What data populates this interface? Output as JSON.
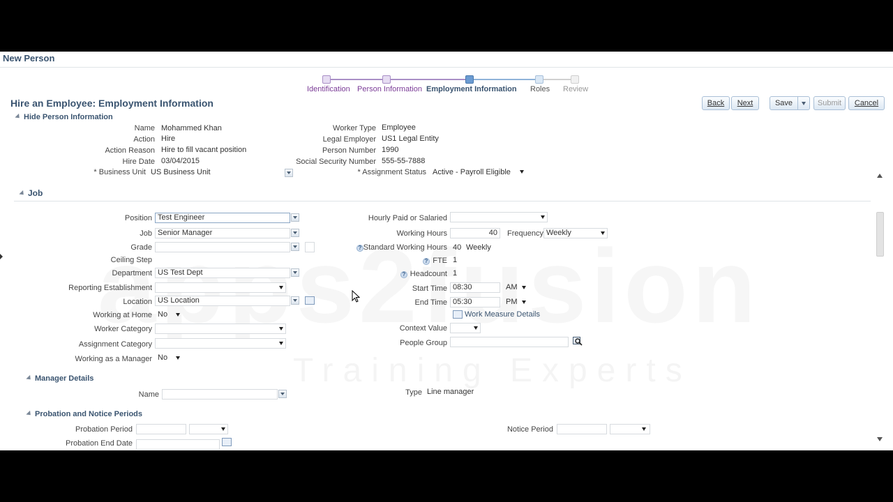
{
  "page": {
    "title": "New Person"
  },
  "train": {
    "stops": [
      {
        "label": "Identification",
        "state": "visited"
      },
      {
        "label": "Person Information",
        "state": "visited"
      },
      {
        "label": "Employment Information",
        "state": "current"
      },
      {
        "label": "Roles",
        "state": "future"
      },
      {
        "label": "Review",
        "state": "disabled"
      }
    ]
  },
  "header": {
    "section_title": "Hire an Employee: Employment Information",
    "buttons": {
      "back": "Back",
      "next": "Next",
      "save": "Save",
      "submit": "Submit",
      "cancel": "Cancel"
    }
  },
  "person_info": {
    "toggle_label": "Hide Person Information",
    "left": [
      {
        "label": "Name",
        "value": "Mohammed Khan"
      },
      {
        "label": "Action",
        "value": "Hire"
      },
      {
        "label": "Action Reason",
        "value": "Hire to fill vacant position"
      },
      {
        "label": "Hire Date",
        "value": "03/04/2015"
      }
    ],
    "right": [
      {
        "label": "Worker Type",
        "value": "Employee"
      },
      {
        "label": "Legal Employer",
        "value": "US1 Legal Entity"
      },
      {
        "label": "Person Number",
        "value": "1990"
      },
      {
        "label": "Social Security Number",
        "value": "555-55-7888"
      }
    ],
    "business_unit": {
      "label": "Business Unit",
      "value": "US Business Unit"
    },
    "assignment_status": {
      "label": "Assignment Status",
      "value": "Active - Payroll Eligible"
    }
  },
  "job": {
    "section_title": "Job",
    "position": {
      "label": "Position",
      "value": "Test Engineer"
    },
    "job": {
      "label": "Job",
      "value": "Senior Manager"
    },
    "grade": {
      "label": "Grade",
      "value": ""
    },
    "ceiling_step": {
      "label": "Ceiling Step",
      "value": ""
    },
    "department": {
      "label": "Department",
      "value": "US Test Dept"
    },
    "reporting_establishment": {
      "label": "Reporting Establishment",
      "value": ""
    },
    "location": {
      "label": "Location",
      "value": "US Location"
    },
    "working_at_home": {
      "label": "Working at Home",
      "value": "No"
    },
    "worker_category": {
      "label": "Worker Category",
      "value": ""
    },
    "assignment_category": {
      "label": "Assignment Category",
      "value": ""
    },
    "working_as_manager": {
      "label": "Working as a Manager",
      "value": "No"
    },
    "hourly_paid": {
      "label": "Hourly Paid or Salaried",
      "value": ""
    },
    "working_hours": {
      "label": "Working Hours",
      "value": "40"
    },
    "frequency": {
      "label": "Frequency",
      "value": "Weekly"
    },
    "standard_working_hours": {
      "label": "Standard Working Hours",
      "value": "40",
      "unit": "Weekly"
    },
    "fte": {
      "label": "FTE",
      "value": "1"
    },
    "headcount": {
      "label": "Headcount",
      "value": "1"
    },
    "start_time": {
      "label": "Start Time",
      "value": "08:30",
      "ampm": "AM"
    },
    "end_time": {
      "label": "End Time",
      "value": "05:30",
      "ampm": "PM"
    },
    "work_measure_link": "Work Measure Details",
    "context_value": {
      "label": "Context Value",
      "value": ""
    },
    "people_group": {
      "label": "People Group",
      "value": ""
    }
  },
  "manager_details": {
    "section_title": "Manager Details",
    "name": {
      "label": "Name",
      "value": ""
    },
    "type": {
      "label": "Type",
      "value": "Line manager"
    }
  },
  "probation": {
    "section_title": "Probation and Notice Periods",
    "probation_period": {
      "label": "Probation Period",
      "value": ""
    },
    "probation_end_date": {
      "label": "Probation End Date",
      "value": ""
    },
    "notice_period": {
      "label": "Notice Period",
      "value": ""
    }
  },
  "watermark": {
    "line1": "apps2fusion",
    "line2": "Training Experts"
  }
}
